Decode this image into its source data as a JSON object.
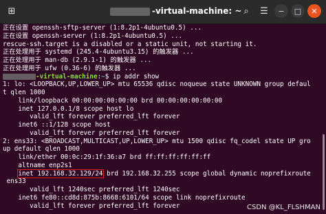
{
  "window": {
    "title_suffix": "-virtual-machine: ~",
    "icons": {
      "tab": "new-tab-icon",
      "search": "search-icon",
      "menu": "hamburger-menu-icon",
      "minimize": "minimize-icon",
      "maximize": "maximize-icon",
      "close": "close-icon"
    }
  },
  "terminal": {
    "lines_before": [
      "正在设置 openssh-sftp-server (1:8.2p1-4ubuntu0.5) ...",
      "正在设置 openssh-server (1:8.2p1-4ubuntu0.5) ...",
      "rescue-ssh.target is a disabled or a static unit, not starting it.",
      "正在处理用于 systemd (245.4-4ubuntu3.15) 的触发器 ...",
      "正在处理用于 man-db (2.9.1-1) 的触发器 ...",
      "正在处理用于 ufw (0.36-6) 的触发器 ..."
    ],
    "prompt": {
      "user_suffix": "-virtual-machine",
      "path": "~",
      "command": "$ ip addr show"
    },
    "lines_after": [
      "1: lo: <LOOPBACK,UP,LOWER_UP> mtu 65536 qdisc noqueue state UNKNOWN group defaul",
      "t qlen 1000",
      "    link/loopback 00:00:00:00:00:00 brd 00:00:00:00:00:00",
      "    inet 127.0.0.1/8 scope host lo",
      "       valid_lft forever preferred_lft forever",
      "    inet6 ::1/128 scope host",
      "       valid_lft forever preferred_lft forever",
      "2: ens33: <BROADCAST,MULTICAST,UP,LOWER_UP> mtu 1500 qdisc fq_codel state UP gro",
      "up default qlen 1000",
      "    link/ether 00:0c:29:1f:36:a7 brd ff:ff:ff:ff:ff:ff",
      "    altname enp2s1"
    ],
    "inet_line": {
      "indent": "    ",
      "highlighted": "inet 192.168.32.129/24",
      "rest": " brd 192.168.32.255 scope global dynamic noprefixroute"
    },
    "lines_end": [
      " ens33",
      "       valid_lft 1240sec preferred_lft 1240sec",
      "    inet6 fe80::cd8d:875b:8668:6101/64 scope link noprefixroute",
      "       valid_lft forever preferred_lft forever"
    ]
  },
  "watermark": "CSDN @KL_FLSHMAN"
}
